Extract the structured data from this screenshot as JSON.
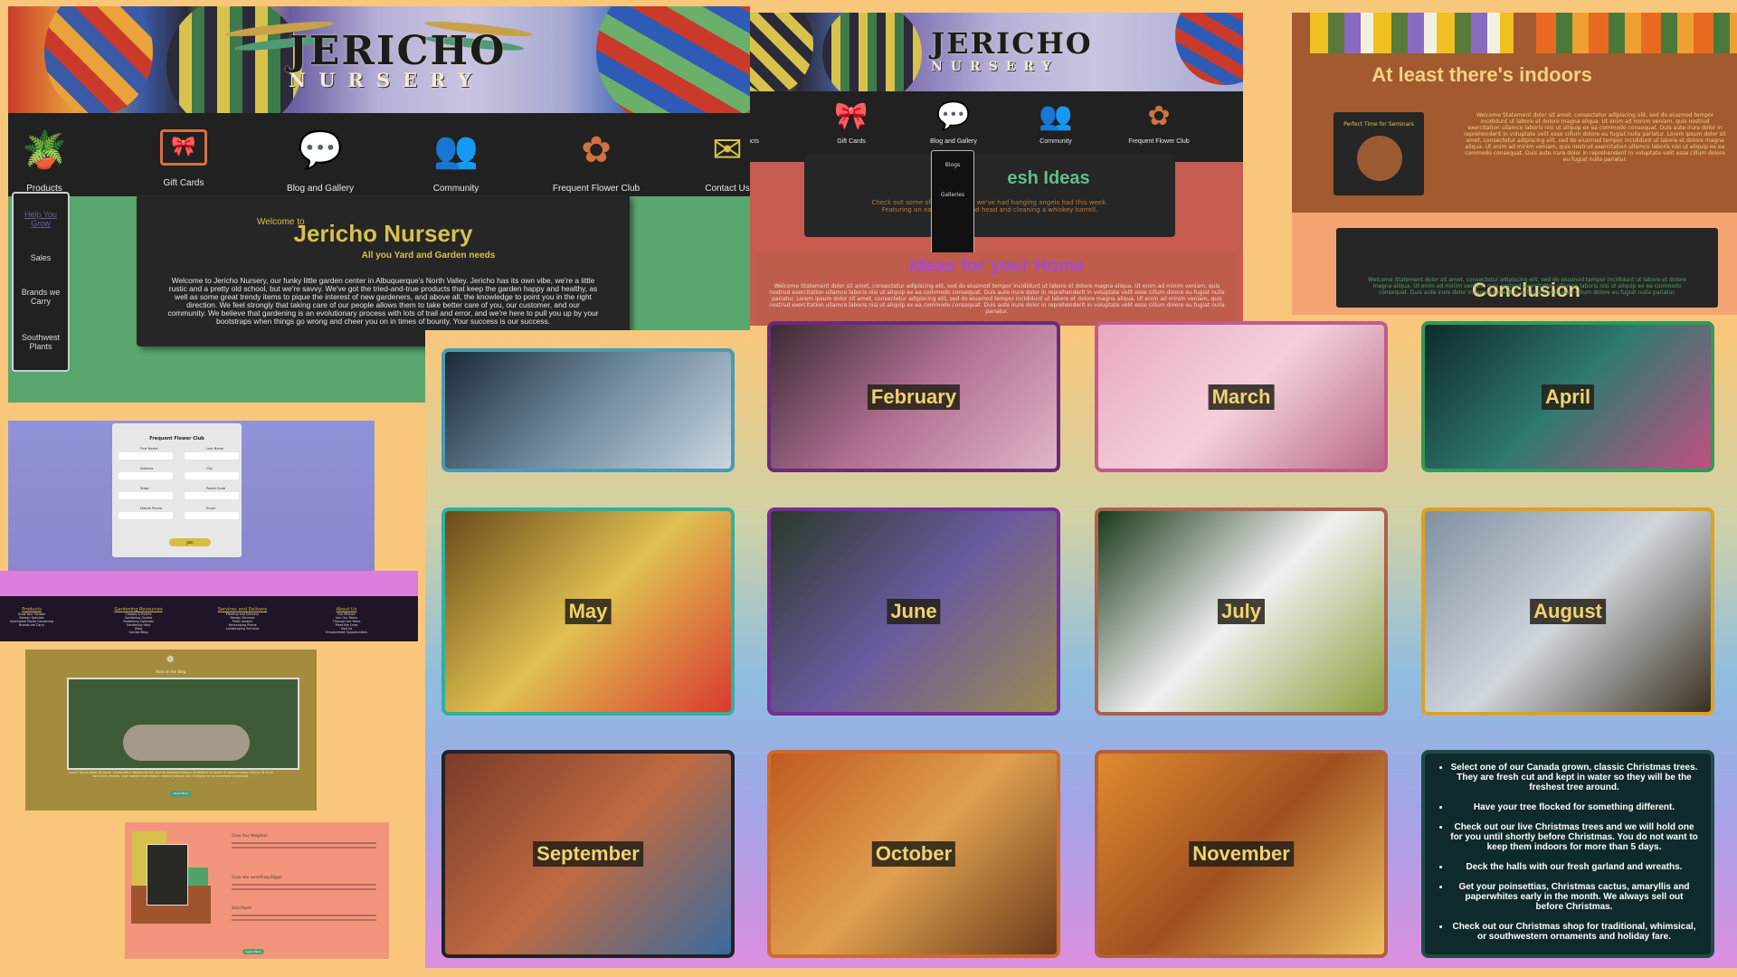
{
  "home": {
    "logo": {
      "name": "JERICHO",
      "sub": "NURSERY"
    },
    "nav": [
      {
        "label": "Products",
        "icon": "plant-icon"
      },
      {
        "label": "Gift Cards",
        "icon": "gift-card-icon"
      },
      {
        "label": "Blog and Gallery",
        "icon": "chat-camera-icon"
      },
      {
        "label": "Community",
        "icon": "people-icon"
      },
      {
        "label": "Frequent Flower Club",
        "icon": "flower-icon"
      },
      {
        "label": "Contact Us",
        "icon": "phone-mail-icon"
      }
    ],
    "side_menu": [
      "Help You Grow",
      "Sales",
      "Brands we Carry",
      "Southwest Plants"
    ],
    "welcome_to": "Welcome to",
    "title": "Jericho Nursery",
    "tagline": "All you Yard and Garden needs",
    "body": "Welcome to Jericho Nursery, our funky little garden center in Albuquerque's North Valley. Jericho has its own vibe, we're a little rustic and a pretty old school, but we're savvy. We've got the tried-and-true products that keep the garden happy and healthy, as well as some great trendy items to pique the interest of new gardeners, and above all, the knowledge to point you in the right direction. We feel strongly that taking care of our people allows them to take better care of you, our customer, and our community. We believe that gardening is an evolutionary process with lots of trail and error, and we're here to pull you up by your bootstraps when things go wrong and cheer you on in times of bounty. Your success is our success."
  },
  "blog": {
    "logo": {
      "name": "JERICHO",
      "sub": "NURSERY"
    },
    "nav": [
      {
        "label": "Gift Cards",
        "icon": "gift-card-icon"
      },
      {
        "label": "Blog and Gallery",
        "icon": "chat-camera-icon"
      },
      {
        "label": "Community",
        "icon": "people-icon"
      },
      {
        "label": "Frequent Flower Club",
        "icon": "flower-icon"
      }
    ],
    "nav_partial": "ucts",
    "dropdown": [
      "Blogs",
      "Galleries"
    ],
    "fresh_title": "esh Ideas",
    "fresh_text": "Check out some of the ideas the we've had hanging angels had this week. Featuring an easy way to dead head and cleaning a whiskey barrell.",
    "ideas_title": "Ideas for your Home",
    "ideas_text": "Welcome Statement dolor sit amet, consectetur adipiscing elit, sed do eiusmod tempor incididunt ut labore et dolore magna aliqua. Ut enim ad minim veniam, quis nostrud exercitation ullamco laboris nisi ut aliquip ex ea commodo consequat. Duis aute irure dolor in reprehenderit in voluptate velit esse cillum dolore eu fugiat nulla pariatur. Lorem ipsum dolor sit amet, consectetur adipiscing elit, sed do eiusmod tempor incididunt ut labore et dolore magna aliqua. Ut enim ad minim veniam, quis nostrud exercitation ullamco laboris nisi ut aliquip ex ea commodo consequat. Duis aute irure dolor in reprehenderit in voluptate velit esse cillum dolore eu fugiat nulla pariatur."
  },
  "indoors": {
    "title": "At least there's indoors",
    "seminar_title": "Perfect Time for Seminars",
    "text": "Welcome Statement dolor sit amet, consectetur adipiscing elit, sed do eiusmod tempor incididunt ut labore et dolore magna aliqua. Ut enim ad minim veniam, quis nostrud exercitation ullamco laboris nisi ut aliquip ex ea commodo consequat. Duis aute irure dolor in reprehenderit in voluptate velit esse cillum dolore eu fugiat nulla pariatur. Lorem ipsum dolor sit amet, consectetur adipiscing elit, sed do eiusmod tempor incididunt ut labore et dolore magna aliqua. Ut enim ad minim veniam, quis nostrud exercitation ullamco laboris nisi ut aliquip ex ea commodo consequat. Duis aute irure dolor in reprehenderit in voluptate velit esse cillum dolore eu fugiat nulla pariatur.",
    "conclusion_title": "Conclusion",
    "conclusion_text": "Welcome Statement dolor sit amet, consectetur adipiscing elit, sed do eiusmod tempor incididunt ut labore et dolore magna aliqua. Ut enim ad minim veniam, quis nostrud exercitation ullamco laboris nisi ut aliquip ex ea commodo consequat. Duis aute irure dolor in reprehenderit in voluptate velit esse cillum dolore eu fugiat nulla pariatur."
  },
  "months": [
    {
      "label": "",
      "border": "#4a9ab5",
      "colors": [
        "#1d2a38",
        "#6f8aa0",
        "#c9d6e0"
      ]
    },
    {
      "label": "February",
      "border": "#6b2a7a",
      "colors": [
        "#3a2a35",
        "#b07090",
        "#e0b4c8"
      ]
    },
    {
      "label": "March",
      "border": "#c45a8a",
      "colors": [
        "#e8a8c0",
        "#f4d0dc",
        "#b86a88"
      ]
    },
    {
      "label": "April",
      "border": "#2f9a5a",
      "colors": [
        "#0f2a2a",
        "#2f7a70",
        "#c05080"
      ]
    },
    {
      "label": "May",
      "border": "#2fb0a0",
      "colors": [
        "#6a4a1a",
        "#e0c050",
        "#d83a30"
      ]
    },
    {
      "label": "June",
      "border": "#7a2a9a",
      "colors": [
        "#2a3a2a",
        "#6a5aa0",
        "#9a8a50"
      ]
    },
    {
      "label": "July",
      "border": "#b0604a",
      "colors": [
        "#1a3a1a",
        "#f0f0f0",
        "#8aa040"
      ]
    },
    {
      "label": "August",
      "border": "#e0a020",
      "colors": [
        "#8090a0",
        "#d0d6dc",
        "#3a3020"
      ]
    },
    {
      "label": "September",
      "border": "#222222",
      "colors": [
        "#7a3a2a",
        "#c06a40",
        "#3a6aa0"
      ]
    },
    {
      "label": "October",
      "border": "#d06a2a",
      "colors": [
        "#c05a20",
        "#e0a050",
        "#6a3a1a"
      ]
    },
    {
      "label": "November",
      "border": "#b0603a",
      "colors": [
        "#e08a30",
        "#a05020",
        "#f0c060"
      ]
    }
  ],
  "christmas_tips": [
    "Select one of our Canada grown, classic Christmas trees. They are fresh cut and kept in water so they will be the freshest tree around.",
    "Have your tree flocked for something different.",
    "Check out our live Christmas trees and we will hold one for you until shortly before Christmas. You do not want to keep them indoors for more than 5 days.",
    "Deck the halls with our fresh garland and wreaths.",
    "Get your poinsettias, Christmas cactus, amaryllis and paperwhites early in the month. We always sell out before Christmas.",
    "Check out our Christmas shop for traditional, whimsical, or southwestern ornaments and holiday fare."
  ],
  "form": {
    "title": "Frequent Flower Club",
    "fields": [
      "First Name",
      "Last Name",
      "Address",
      "City",
      "State",
      "Postal Code",
      "Mobile Phone",
      "Email"
    ],
    "submit": "Join"
  },
  "footer": {
    "columns": [
      {
        "heading": "Products",
        "items": [
          "Grow Your Garden",
          "Season Specials",
          "Southwest Plants Gardening",
          "Brands we Carry"
        ]
      },
      {
        "heading": "Gardening Resources",
        "items": [
          "Classes & Events",
          "Gardening Guides",
          "Gardening Calendar",
          "Gardening Help",
          "Blog",
          "Garden Blog"
        ]
      },
      {
        "heading": "Services and Delivery",
        "items": [
          "Planting and Delivery",
          "Design Services",
          "Plant Locator",
          "Xeriscaping Plants",
          "Landscaping Services"
        ]
      },
      {
        "heading": "About Us",
        "items": [
          "Our Mission",
          "Join Our Team",
          "Through the Years",
          "Meet the Crew",
          "Visit Us",
          "Employment Opportunities"
        ]
      }
    ]
  },
  "blogcard": {
    "title": "New on the Blog",
    "text": "Lorem ipsum dolor sit amet, consectetur adipiscing elit, sed do eiusmod tempor incididunt ut labore et dolore magna aliqua. Ut enim ad minim veniam, quis nostrud exercitation ullamco laboris nisi ut aliquip ex ea commodo consequat.",
    "button": "Read More"
  },
  "salmon": {
    "h1": "Grow Your Neighbor",
    "h2": "Grow into something Bigger",
    "h3": "Solid Roots",
    "button": "Learn More"
  }
}
